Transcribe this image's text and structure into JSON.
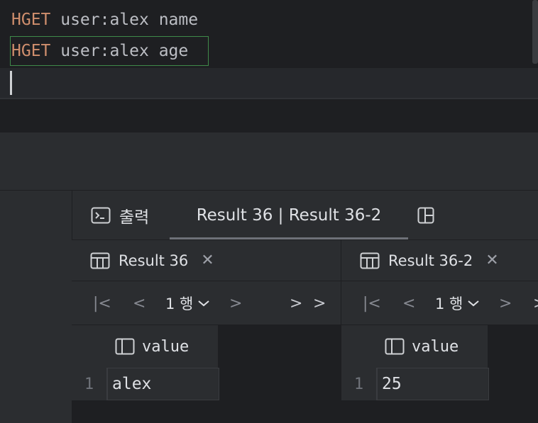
{
  "editor": {
    "lines": [
      {
        "keyword": "HGET",
        "args": " user:alex name"
      },
      {
        "keyword": "HGET",
        "args": " user:alex age"
      }
    ]
  },
  "services": {
    "tabs": {
      "output_label": "출력",
      "results_label": "Result 36 | Result 36-2"
    },
    "panes": [
      {
        "title": "Result 36",
        "row_selector": "1 행",
        "column": "value",
        "row_number": "1",
        "cell_value": "alex"
      },
      {
        "title": "Result 36-2",
        "row_selector": "1 행",
        "column": "value",
        "row_number": "1",
        "cell_value": "25"
      }
    ]
  },
  "icons": {
    "output": "console-icon",
    "split": "split-layout-icon",
    "table": "table-icon",
    "column": "column-icon",
    "close": "close-icon"
  }
}
